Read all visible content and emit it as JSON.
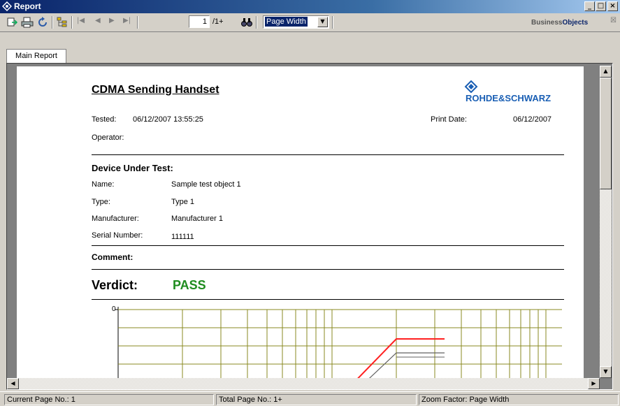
{
  "window": {
    "title": "Report"
  },
  "toolbar": {
    "page_value": "1",
    "page_total": "/1+",
    "zoom_value": "Page Width",
    "brand": "Business",
    "brand_bold": "Objects",
    "icons": [
      "export-icon",
      "print-icon",
      "refresh-icon",
      "group-tree-icon",
      "first-page-icon",
      "previous-page-icon",
      "next-page-icon",
      "last-page-icon",
      "search-binoculars-icon"
    ]
  },
  "tabs": [
    {
      "label": "Main Report"
    }
  ],
  "report": {
    "title": "CDMA Sending Handset",
    "logo_text": "ROHDE&SCHWARZ",
    "tested_label": "Tested:",
    "tested_value": "06/12/2007 13:55:25",
    "print_date_label": "Print Date:",
    "print_date_value": "06/12/2007",
    "operator_label": "Operator:",
    "dut_heading": "Device Under Test:",
    "dut_rows": [
      {
        "label": "Name:",
        "value": "Sample test object 1"
      },
      {
        "label": "Type:",
        "value": "Type 1"
      },
      {
        "label": "Manufacturer:",
        "value": "Manufacturer 1"
      },
      {
        "label": "Serial Number:",
        "value": "111111"
      }
    ],
    "comment_label": "Comment:",
    "verdict_label": "Verdict:",
    "verdict_value": "PASS",
    "verdict_color": "#1e8c1e",
    "chart_y_tick": "0",
    "limit_color": "#ff2020",
    "trace_color": "#606060"
  },
  "status": {
    "current_page": "Current Page No.: 1",
    "total_page": "Total Page No.: 1+",
    "zoom_factor": "Zoom Factor: Page Width"
  }
}
